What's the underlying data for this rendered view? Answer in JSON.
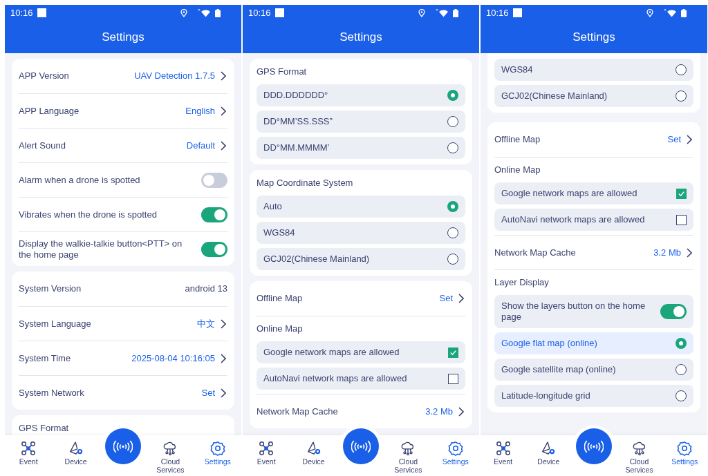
{
  "screens": [
    {
      "status": {
        "time": "10:16"
      },
      "title": "Settings",
      "cards": [
        {
          "top_cut": false,
          "items": [
            {
              "kind": "link",
              "label": "APP Version",
              "value": "UAV Detection 1.7.5"
            },
            {
              "kind": "link",
              "label": "APP Language",
              "value": "English"
            },
            {
              "kind": "link",
              "label": "Alert Sound",
              "value": "Default"
            },
            {
              "kind": "toggle",
              "label": "Alarm when a drone is spotted",
              "on": false
            },
            {
              "kind": "toggle",
              "label": "Vibrates when the drone is spotted",
              "on": true
            },
            {
              "kind": "toggle",
              "label": "Display the walkie-talkie button<PTT> on the home page",
              "on": true
            }
          ]
        },
        {
          "top_cut": false,
          "items": [
            {
              "kind": "info",
              "label": "System Version",
              "value": "android 13"
            },
            {
              "kind": "link",
              "label": "System Language",
              "value": "中文"
            },
            {
              "kind": "link",
              "label": "System Time",
              "value": "2025-08-04 10:16:05"
            },
            {
              "kind": "link",
              "label": "System Network",
              "value": "Set"
            }
          ]
        },
        {
          "top_cut": false,
          "items": [
            {
              "kind": "heading",
              "label": "GPS Format"
            }
          ]
        }
      ],
      "nav": [
        {
          "kind": "drone",
          "label": "Event",
          "selected": false
        },
        {
          "kind": "device",
          "label": "Device",
          "selected": false
        },
        {
          "kind": "radar",
          "selected": false
        },
        {
          "kind": "cloud",
          "label": "Cloud Services",
          "selected": false
        },
        {
          "kind": "gear",
          "label": "Settings",
          "selected": true
        }
      ]
    },
    {
      "status": {
        "time": "10:16"
      },
      "title": "Settings",
      "cards": [
        {
          "top_cut": false,
          "items": [
            {
              "kind": "heading",
              "label": "GPS Format"
            },
            {
              "kind": "radio",
              "label": "DDD.DDDDDD°",
              "selected": true,
              "highlighted": false
            },
            {
              "kind": "radio",
              "label": "DD°MM’SS.SSS”",
              "selected": false,
              "highlighted": false
            },
            {
              "kind": "radio",
              "label": "DD°MM.MMMM’",
              "selected": false,
              "highlighted": false
            }
          ]
        },
        {
          "top_cut": false,
          "items": [
            {
              "kind": "heading",
              "label": "Map Coordinate System"
            },
            {
              "kind": "radio",
              "label": "Auto",
              "selected": true,
              "highlighted": false
            },
            {
              "kind": "radio",
              "label": "WGS84",
              "selected": false,
              "highlighted": false
            },
            {
              "kind": "radio",
              "label": "GCJ02(Chinese Mainland)",
              "selected": false,
              "highlighted": false
            }
          ]
        },
        {
          "top_cut": false,
          "items": [
            {
              "kind": "link",
              "label": "Offline Map",
              "value": "Set"
            },
            {
              "kind": "heading",
              "label": "Online Map"
            },
            {
              "kind": "check",
              "label": "Google network maps are allowed",
              "checked": true
            },
            {
              "kind": "check",
              "label": "AutoNavi network maps are allowed",
              "checked": false
            },
            {
              "kind": "link",
              "label": "Network Map Cache",
              "value": "3.2 Mb"
            }
          ]
        }
      ],
      "nav": [
        {
          "kind": "drone",
          "label": "Event",
          "selected": false
        },
        {
          "kind": "device",
          "label": "Device",
          "selected": false
        },
        {
          "kind": "radar",
          "selected": false
        },
        {
          "kind": "cloud",
          "label": "Cloud Services",
          "selected": false
        },
        {
          "kind": "gear",
          "label": "Settings",
          "selected": true
        }
      ]
    },
    {
      "status": {
        "time": "10:16"
      },
      "title": "Settings",
      "cards": [
        {
          "top_cut": true,
          "items": [
            {
              "kind": "radio",
              "label": "WGS84",
              "selected": false,
              "highlighted": false
            },
            {
              "kind": "radio",
              "label": "GCJ02(Chinese Mainland)",
              "selected": false,
              "highlighted": false
            }
          ]
        },
        {
          "top_cut": false,
          "items": [
            {
              "kind": "link",
              "label": "Offline Map",
              "value": "Set"
            },
            {
              "kind": "heading",
              "label": "Online Map"
            },
            {
              "kind": "check",
              "label": "Google network maps are allowed",
              "checked": true
            },
            {
              "kind": "check",
              "label": "AutoNavi network maps are allowed",
              "checked": false
            },
            {
              "kind": "link",
              "label": "Network Map Cache",
              "value": "3.2 Mb"
            },
            {
              "kind": "heading",
              "label": "Layer Display"
            },
            {
              "kind": "toggle_row",
              "label": "Show the layers button on the home page",
              "on": true
            },
            {
              "kind": "radio",
              "label": "Google flat map (online)",
              "selected": true,
              "highlighted": true
            },
            {
              "kind": "radio",
              "label": "Google satellite map (online)",
              "selected": false,
              "highlighted": false
            },
            {
              "kind": "radio",
              "label": "Latitude-longitude grid",
              "selected": false,
              "highlighted": false
            }
          ]
        }
      ],
      "nav": [
        {
          "kind": "drone",
          "label": "Event",
          "selected": false
        },
        {
          "kind": "device",
          "label": "Device",
          "selected": false
        },
        {
          "kind": "radar",
          "selected": false
        },
        {
          "kind": "cloud",
          "label": "Cloud Services",
          "selected": false
        },
        {
          "kind": "gear",
          "label": "Settings",
          "selected": true
        }
      ]
    }
  ]
}
